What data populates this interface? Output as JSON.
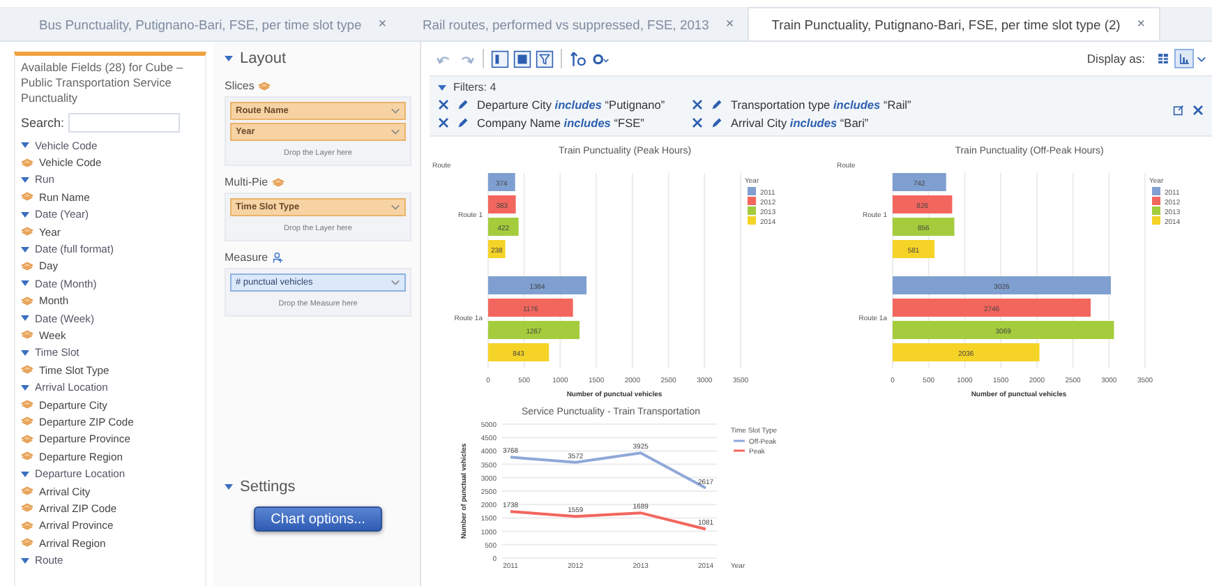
{
  "tabs": [
    {
      "label": "Bus Punctuality, Putignano-Bari, FSE, per time slot type",
      "close": "×",
      "selected": false
    },
    {
      "label": "Rail routes, performed vs suppressed, FSE, 2013",
      "close": "×",
      "selected": false
    },
    {
      "label": "Train Punctuality, Putignano-Bari, FSE, per time slot type (2)",
      "close": "×",
      "selected": true
    }
  ],
  "fields_panel": {
    "title": "Available Fields (28) for Cube – Public Transportation Service Punctuality",
    "search_label": "Search:",
    "items": [
      {
        "kind": "dimension",
        "label": "Vehicle Code"
      },
      {
        "kind": "level",
        "label": "Vehicle Code"
      },
      {
        "kind": "dimension",
        "label": "Run"
      },
      {
        "kind": "level",
        "label": "Run Name"
      },
      {
        "kind": "dimension",
        "label": "Date (Year)"
      },
      {
        "kind": "level",
        "label": "Year"
      },
      {
        "kind": "dimension",
        "label": "Date (full format)"
      },
      {
        "kind": "level",
        "label": "Day"
      },
      {
        "kind": "dimension",
        "label": "Date (Month)"
      },
      {
        "kind": "level",
        "label": "Month"
      },
      {
        "kind": "dimension",
        "label": "Date (Week)"
      },
      {
        "kind": "level",
        "label": "Week"
      },
      {
        "kind": "dimension",
        "label": "Time Slot"
      },
      {
        "kind": "level",
        "label": "Time Slot Type"
      },
      {
        "kind": "dimension",
        "label": "Arrival Location"
      },
      {
        "kind": "level",
        "label": "Departure City"
      },
      {
        "kind": "level",
        "label": "Departure ZIP Code"
      },
      {
        "kind": "level",
        "label": "Departure Province"
      },
      {
        "kind": "level",
        "label": "Departure Region"
      },
      {
        "kind": "dimension",
        "label": "Departure Location"
      },
      {
        "kind": "level",
        "label": "Arrival City"
      },
      {
        "kind": "level",
        "label": "Arrival ZIP Code"
      },
      {
        "kind": "level",
        "label": "Arrival Province"
      },
      {
        "kind": "level",
        "label": "Arrival Region"
      },
      {
        "kind": "dimension",
        "label": "Route"
      }
    ]
  },
  "layout_panel": {
    "title": "Layout",
    "sections": [
      {
        "kind": "layer",
        "label": "Slices",
        "items": [
          "Route Name",
          "Year"
        ],
        "drop_hint": "Drop the Layer here"
      },
      {
        "kind": "layer",
        "label": "Multi-Pie",
        "items": [
          "Time Slot Type"
        ],
        "drop_hint": "Drop the Layer here"
      },
      {
        "kind": "measure",
        "label": "Measure",
        "items": [
          "# punctual vehicles"
        ],
        "drop_hint": "Drop the Measure here"
      }
    ],
    "settings_title": "Settings",
    "settings_button": "Chart options..."
  },
  "toolbar": {
    "display_label": "Display as:",
    "display_modes": [
      {
        "kind": "table",
        "selected": false
      },
      {
        "kind": "chart",
        "selected": true
      }
    ]
  },
  "filters": {
    "title": "Filters: 4",
    "items": [
      {
        "field": "Departure City",
        "operator": "includes",
        "value": "“Putignano”"
      },
      {
        "field": "Transportation type",
        "operator": "includes",
        "value": "“Rail”"
      },
      {
        "field": "Company Name",
        "operator": "includes",
        "value": "“FSE”"
      },
      {
        "field": "Arrival City",
        "operator": "includes",
        "value": "“Bari”"
      }
    ]
  },
  "charts": [
    {
      "chart_data": {
        "type": "bar",
        "orientation": "horizontal",
        "title": "Train Punctuality (Peak Hours)",
        "xlabel": "Number of punctual vehicles",
        "ylabel": "Route",
        "legend": {
          "title": "Year"
        },
        "grid": true,
        "categories": [
          "Route 1",
          "Route 1a"
        ],
        "series": [
          {
            "name": "2011",
            "color": "#7f9fd0",
            "values": [
              374,
              1364
            ]
          },
          {
            "name": "2012",
            "color": "#f2665e",
            "values": [
              383,
              1176
            ]
          },
          {
            "name": "2013",
            "color": "#a4cc3c",
            "values": [
              422,
              1267
            ]
          },
          {
            "name": "2014",
            "color": "#f5d327",
            "values": [
              238,
              843
            ]
          }
        ],
        "xlim": [
          0,
          3500
        ],
        "xticks": [
          0,
          500,
          1000,
          1500,
          2000,
          2500,
          3000,
          3500
        ],
        "data_labels": true
      }
    },
    {
      "chart_data": {
        "type": "bar",
        "orientation": "horizontal",
        "title": "Train Punctuality (Off-Peak Hours)",
        "xlabel": "Number of punctual vehicles",
        "ylabel": "Route",
        "legend": {
          "title": "Year"
        },
        "grid": true,
        "categories": [
          "Route 1",
          "Route 1a"
        ],
        "series": [
          {
            "name": "2011",
            "color": "#7f9fd0",
            "values": [
              742,
              3026
            ]
          },
          {
            "name": "2012",
            "color": "#f2665e",
            "values": [
              826,
              2746
            ]
          },
          {
            "name": "2013",
            "color": "#a4cc3c",
            "values": [
              856,
              3069
            ]
          },
          {
            "name": "2014",
            "color": "#f5d327",
            "values": [
              581,
              2036
            ]
          }
        ],
        "xlim": [
          0,
          3500
        ],
        "xticks": [
          0,
          500,
          1000,
          1500,
          2000,
          2500,
          3000,
          3500
        ],
        "data_labels": true
      }
    },
    {
      "chart_data": {
        "type": "line",
        "title": "Service Punctuality - Train Transportation",
        "xlabel": "Year",
        "ylabel": "Number of punctual vehicles",
        "legend": {
          "title": "Time Slot Type"
        },
        "grid": true,
        "categories": [
          "2011",
          "2012",
          "2013",
          "2014"
        ],
        "series": [
          {
            "name": "Off-Peak",
            "color": "#8fa8d8",
            "values": [
              3768,
              3572,
              3925,
              2617
            ]
          },
          {
            "name": "Peak",
            "color": "#f2665e",
            "values": [
              1738,
              1559,
              1689,
              1081
            ]
          }
        ],
        "ylim": [
          0,
          5000
        ],
        "yticks": [
          0,
          500,
          1000,
          1500,
          2000,
          2500,
          3000,
          3500,
          4000,
          4500,
          5000
        ],
        "data_labels": true
      }
    }
  ]
}
